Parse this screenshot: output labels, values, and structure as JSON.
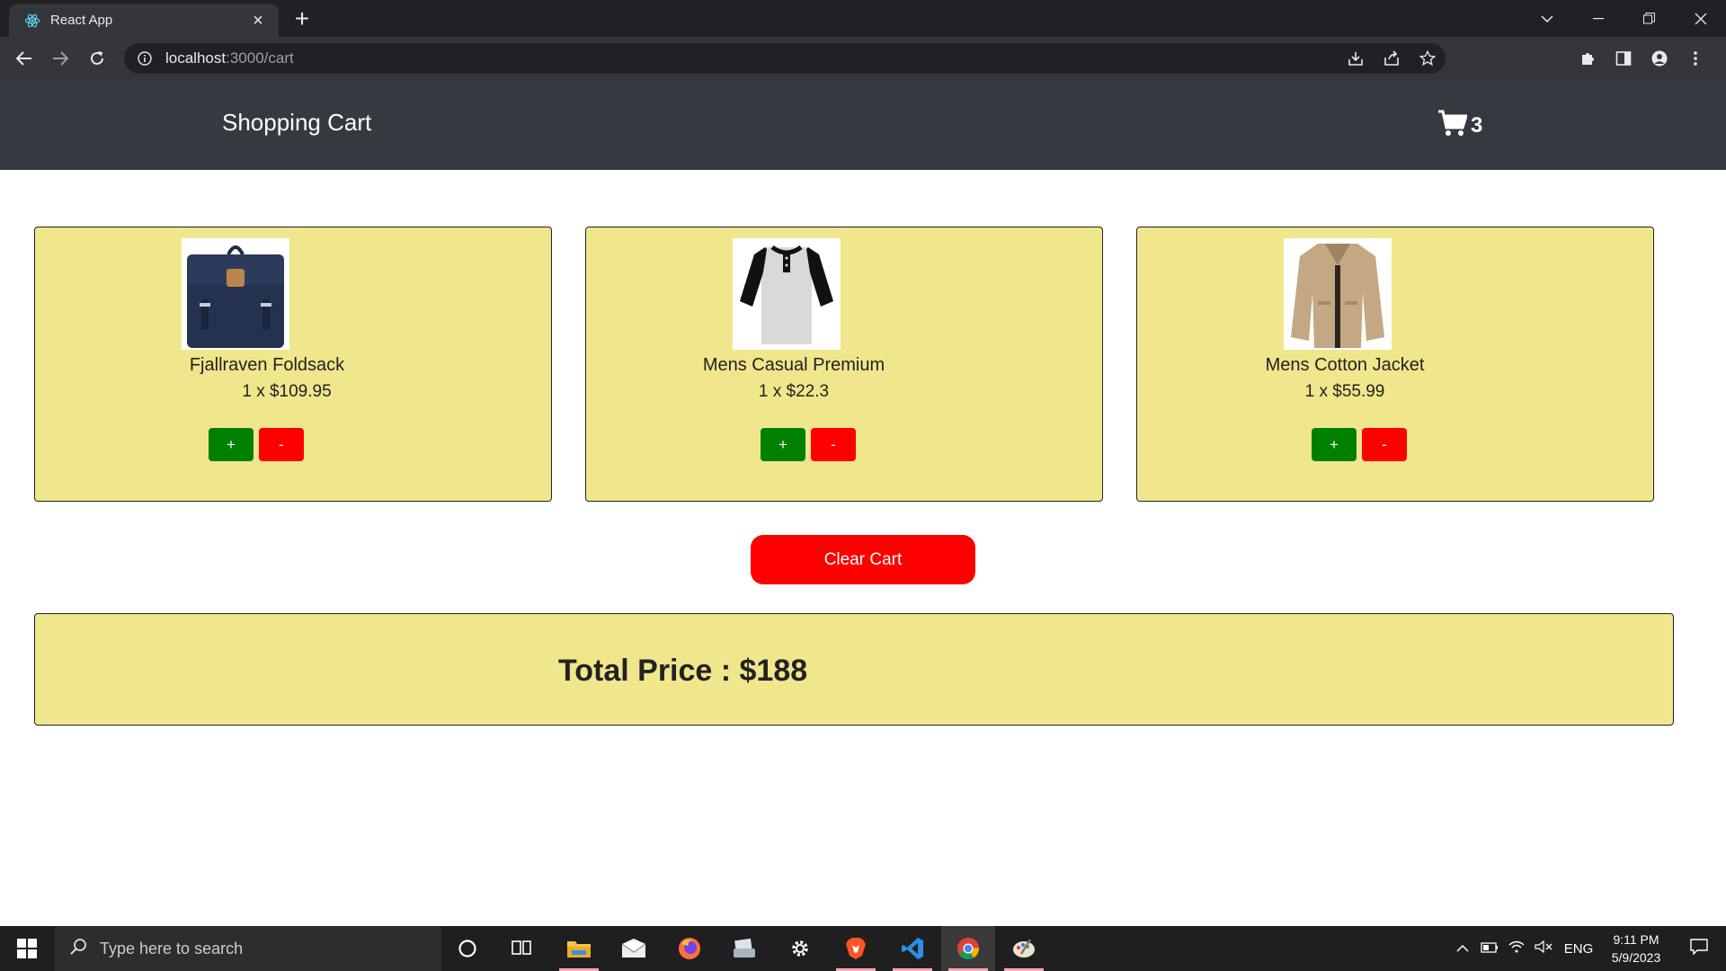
{
  "browser": {
    "tab_title": "React App",
    "url_host": "localhost",
    "url_path": ":3000/cart"
  },
  "header": {
    "title": "Shopping Cart",
    "cart_count": "3"
  },
  "products": [
    {
      "name": "Fjallraven Foldsack",
      "qty_price": "1 x $109.95",
      "plus_label": "+",
      "minus_label": "-",
      "image": "backpack"
    },
    {
      "name": "Mens Casual Premium",
      "qty_price": "1 x $22.3",
      "plus_label": "+",
      "minus_label": "-",
      "image": "raglan-tshirt"
    },
    {
      "name": "Mens Cotton Jacket",
      "qty_price": "1 x $55.99",
      "plus_label": "+",
      "minus_label": "-",
      "image": "cotton-jacket"
    }
  ],
  "clear_label": "Clear Cart",
  "total_text": "Total Price : $188",
  "colors": {
    "header_bg": "#343a40",
    "card_bg": "#f0e68c",
    "plus_btn": "#008000",
    "minus_btn": "#ff0000",
    "clear_btn": "#ff0000"
  },
  "taskbar": {
    "search_placeholder": "Type here to search",
    "language": "ENG",
    "time": "9:11 PM",
    "date": "5/9/2023"
  }
}
